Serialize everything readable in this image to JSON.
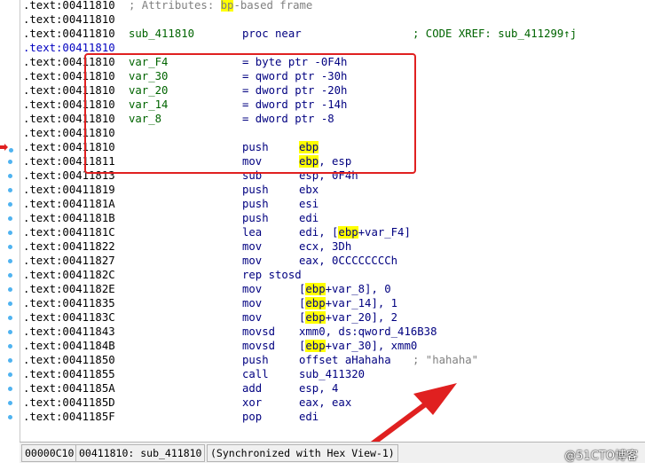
{
  "listing": {
    "rows": [
      {
        "addr": ".text:00411810",
        "attr_prefix": "; Attributes: ",
        "attr_hl": "bp",
        "attr_suffix": "-based frame"
      },
      {
        "addr": ".text:00411810"
      },
      {
        "addr": ".text:00411810",
        "label": "sub_411810",
        "mnemonic": "proc near",
        "xref": "; CODE XREF: sub_411299↑j"
      },
      {
        "addr": ".text:00411810",
        "addr_hl": true
      },
      {
        "addr": ".text:00411810",
        "label": "var_F4",
        "mnemonic": "= byte ptr -0F4h"
      },
      {
        "addr": ".text:00411810",
        "label": "var_30",
        "mnemonic": "= qword ptr -30h"
      },
      {
        "addr": ".text:00411810",
        "label": "var_20",
        "mnemonic": "= dword ptr -20h"
      },
      {
        "addr": ".text:00411810",
        "label": "var_14",
        "mnemonic": "= dword ptr -14h"
      },
      {
        "addr": ".text:00411810",
        "label": "var_8",
        "mnemonic": "= dword ptr -8"
      },
      {
        "addr": ".text:00411810"
      },
      {
        "addr": ".text:00411810",
        "mnemonic": "push",
        "op_hl": "ebp",
        "op_rest": ""
      },
      {
        "addr": ".text:00411811",
        "mnemonic": "mov",
        "op_hl": "ebp",
        "op_rest": ", esp"
      },
      {
        "addr": ".text:00411813",
        "mnemonic": "sub",
        "op_pre": "esp, 0F4h"
      },
      {
        "addr": ".text:00411819",
        "mnemonic": "push",
        "op_pre": "ebx"
      },
      {
        "addr": ".text:0041181A",
        "mnemonic": "push",
        "op_pre": "esi"
      },
      {
        "addr": ".text:0041181B",
        "mnemonic": "push",
        "op_pre": "edi"
      },
      {
        "addr": ".text:0041181C",
        "mnemonic": "lea",
        "op_pre": "edi, [",
        "op_hl": "ebp",
        "op_rest": "+var_F4]"
      },
      {
        "addr": ".text:00411822",
        "mnemonic": "mov",
        "op_pre": "ecx, 3Dh"
      },
      {
        "addr": ".text:00411827",
        "mnemonic": "mov",
        "op_pre": "eax, 0CCCCCCCCh"
      },
      {
        "addr": ".text:0041182C",
        "mnemonic": "rep stosd"
      },
      {
        "addr": ".text:0041182E",
        "mnemonic": "mov",
        "op_pre": "[",
        "op_hl": "ebp",
        "op_rest": "+var_8], 0"
      },
      {
        "addr": ".text:00411835",
        "mnemonic": "mov",
        "op_pre": "[",
        "op_hl": "ebp",
        "op_rest": "+var_14], 1"
      },
      {
        "addr": ".text:0041183C",
        "mnemonic": "mov",
        "op_pre": "[",
        "op_hl": "ebp",
        "op_rest": "+var_20], 2"
      },
      {
        "addr": ".text:00411843",
        "mnemonic": "movsd",
        "op_pre": "xmm0, ds:qword_416B38"
      },
      {
        "addr": ".text:0041184B",
        "mnemonic": "movsd",
        "op_pre": "[",
        "op_hl": "ebp",
        "op_rest": "+var_30], xmm0"
      },
      {
        "addr": ".text:00411850",
        "mnemonic": "push",
        "op_pre": "offset aHahaha",
        "str_cmt": "; \"hahaha\""
      },
      {
        "addr": ".text:00411855",
        "mnemonic": "call",
        "op_pre": "sub_411320"
      },
      {
        "addr": ".text:0041185A",
        "mnemonic": "add",
        "op_pre": "esp, 4"
      },
      {
        "addr": ".text:0041185D",
        "mnemonic": "xor",
        "op_pre": "eax, eax"
      },
      {
        "addr": ".text:0041185F",
        "mnemonic": "pop",
        "op_pre": "edi"
      }
    ]
  },
  "statusbar": {
    "offset": "00000C10",
    "location": "00411810: sub_411810",
    "sync": "(Synchronized with Hex View-1)"
  },
  "watermark": "@51CTO博客",
  "colors": {
    "address": "#000000",
    "label": "#006400",
    "instruction": "#000080",
    "comment": "#808080",
    "highlight": "#ffff00",
    "annotation": "#e02020"
  }
}
